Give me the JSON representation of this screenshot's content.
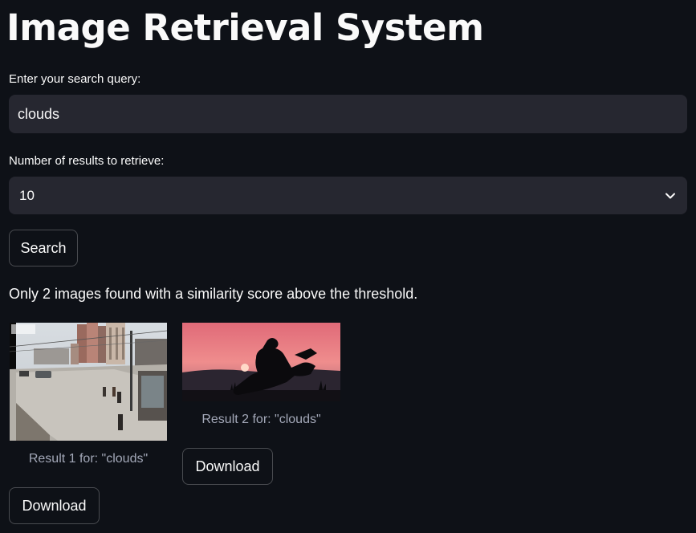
{
  "page": {
    "title": "Image Retrieval System"
  },
  "search": {
    "label": "Enter your search query:",
    "value": "clouds"
  },
  "num_results": {
    "label": "Number of results to retrieve:",
    "selected": "10"
  },
  "search_button": {
    "label": "Search"
  },
  "info_message": "Only 2 images found with a similarity score above the threshold.",
  "results": [
    {
      "caption": "Result 1 for: \"clouds\"",
      "download_label": "Download",
      "image_icon": "street-scene-image"
    },
    {
      "caption": "Result 2 for: \"clouds\"",
      "download_label": "Download",
      "image_icon": "sunset-silhouette-image"
    }
  ],
  "colors": {
    "background": "#0e1117",
    "input_bg": "#262730",
    "text": "#fafafa",
    "caption": "#a3a8b8"
  }
}
